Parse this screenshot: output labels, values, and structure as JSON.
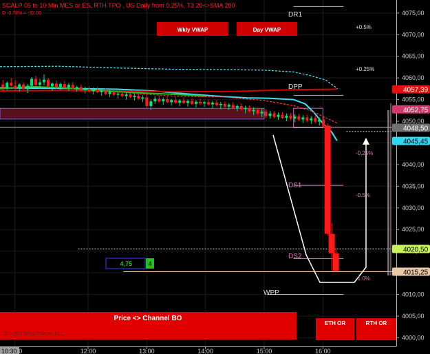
{
  "header": {
    "line1": "SCALP 05 to 10 Min MES or ES, RTH TPO , US Daily from 0.25%, T3 20<>SMA 200",
    "line2": "D -0.78% = -32,00"
  },
  "buttons": {
    "wkly_vwap": "Wkly VWAP",
    "day_vwap": "Day VWAP",
    "channel_bo": "Price <> Channel BO",
    "eth_or": "ETH OR",
    "rth_or": "RTH OR"
  },
  "level_labels": {
    "dr1": "DR1",
    "dpp": "DPP",
    "ds1": "DS1",
    "ds2": "DS2",
    "wpp": "WPP"
  },
  "pct_labels": [
    "+0.5%",
    "+0.25%",
    "-0,25%",
    "-0.5%",
    "-1.0%"
  ],
  "order_box": {
    "value": "4,75",
    "qty": "4"
  },
  "time_badge": "10:30",
  "watermark": "© 2023 NinjaTrader, LLC",
  "colors": {
    "bg": "#000000",
    "up": "#00e676",
    "down": "#ff1a1a",
    "red_panel": "#e00000",
    "vwap_band": "#40e0f0",
    "sma": "#d40000",
    "zone": "#5a0f1e",
    "pink": "#e080c0",
    "cream": "#f0e0c0"
  },
  "chart_data": {
    "type": "candlestick",
    "ylim": [
      3998,
      4078
    ],
    "yticks": [
      "4000,00",
      "4005,00",
      "4010,00",
      "4015,00",
      "4020,00",
      "4025,00",
      "4030,00",
      "4035,00",
      "4040,00",
      "4045,00",
      "4050,00",
      "4055,00",
      "4060,00",
      "4065,00",
      "4070,00",
      "4075,00"
    ],
    "xticks": [
      {
        "label": "11:00",
        "x": 0.25
      },
      {
        "label": "12:00",
        "x": 1.5
      },
      {
        "label": "13:00",
        "x": 2.5
      },
      {
        "label": "14:00",
        "x": 3.5
      },
      {
        "label": "15:00",
        "x": 4.5
      },
      {
        "label": "16:00",
        "x": 5.5
      }
    ],
    "xlim": [
      0,
      6.75
    ],
    "price_tags": [
      {
        "label": "4057,39",
        "value": 4057.39,
        "bg": "#e01010",
        "fg": "#ffffff"
      },
      {
        "label": "4052,75",
        "value": 4052.75,
        "bg": "#d03a6a",
        "fg": "#ffffff"
      },
      {
        "label": "4048,50",
        "value": 4048.5,
        "bg": "#707070",
        "fg": "#ffffff"
      },
      {
        "label": "4045,45",
        "value": 4045.45,
        "bg": "#30d8f0",
        "fg": "#000000"
      },
      {
        "label": "4020,50",
        "value": 4020.5,
        "bg": "#c8f060",
        "fg": "#000000"
      },
      {
        "label": "4015,25",
        "value": 4015.25,
        "bg": "#e8c8a8",
        "fg": "#000000"
      }
    ],
    "levels": [
      {
        "name": "DR1",
        "value": 4076.5
      },
      {
        "name": "DPP",
        "value": 4056.0
      },
      {
        "name": "DS1",
        "value": 4035.2
      },
      {
        "name": "DS2",
        "value": 4018.3
      },
      {
        "name": "WPP",
        "value": 4010.0
      }
    ],
    "zone": {
      "from": 4050.5,
      "to": 4053.0,
      "x0": 0,
      "x1": 4.5
    },
    "box": {
      "from": 4048.5,
      "to": 4053.0,
      "x0": 5.0,
      "x1": 5.5
    },
    "hlines": [
      {
        "value": 4048.6,
        "x0": 0,
        "x1": 6.72,
        "color": "#c8c8c8",
        "dash": false
      },
      {
        "value": 4020.5,
        "x0": 1.33,
        "x1": 6.72,
        "color": "#ffffff",
        "dash": true
      },
      {
        "value": 4015.25,
        "x0": 2.1,
        "x1": 6.72,
        "color": "#e8c8a8",
        "dash": false
      },
      {
        "value": 4047.6,
        "x0": 5.9,
        "x1": 6.72,
        "color": "#ffffff",
        "dash": true
      }
    ],
    "series": [
      {
        "name": "VWAP upper",
        "kind": "dashed",
        "color": "#40e0f0",
        "points": [
          [
            0,
            4062.6
          ],
          [
            1,
            4062.7
          ],
          [
            2,
            4062.3
          ],
          [
            3,
            4062.0
          ],
          [
            4,
            4061.9
          ],
          [
            4.5,
            4061.8
          ],
          [
            5,
            4061.4
          ],
          [
            5.3,
            4060.5
          ],
          [
            5.55,
            4059.5
          ],
          [
            5.75,
            4057.5
          ]
        ]
      },
      {
        "name": "VWAP",
        "kind": "solid",
        "color": "#40e0f0",
        "points": [
          [
            0,
            4057.7
          ],
          [
            1,
            4057.6
          ],
          [
            2,
            4057.4
          ],
          [
            2.6,
            4057.0
          ],
          [
            3.2,
            4056.3
          ],
          [
            3.7,
            4055.8
          ],
          [
            4.2,
            4055.4
          ],
          [
            4.6,
            4055.3
          ],
          [
            5.0,
            4055.0
          ],
          [
            5.2,
            4054.0
          ],
          [
            5.35,
            4052.0
          ],
          [
            5.5,
            4049.5
          ],
          [
            5.65,
            4047.5
          ],
          [
            5.74,
            4045.5
          ]
        ]
      },
      {
        "name": "SMA",
        "kind": "solid",
        "color": "#d40000",
        "points": [
          [
            0,
            4057.0
          ],
          [
            1,
            4057.1
          ],
          [
            2,
            4057.0
          ],
          [
            3,
            4056.8
          ],
          [
            4,
            4056.9
          ],
          [
            5,
            4057.3
          ],
          [
            5.74,
            4057.4
          ]
        ]
      },
      {
        "name": "Green MA",
        "kind": "solid",
        "color": "#20c020",
        "points": [
          [
            0,
            4057.5
          ],
          [
            0.5,
            4058.0
          ],
          [
            1,
            4057.8
          ],
          [
            1.5,
            4057.3
          ],
          [
            2,
            4056.8
          ],
          [
            2.5,
            4056.5
          ],
          [
            3.0,
            4056.2
          ],
          [
            3.5,
            4055.8
          ]
        ]
      },
      {
        "name": "Dashed mid",
        "kind": "dashed",
        "color": "#ff3030",
        "points": [
          [
            2.2,
            4056.5
          ],
          [
            3,
            4055.8
          ],
          [
            3.8,
            4055.6
          ],
          [
            4.5,
            4054.8
          ],
          [
            5.0,
            4053.6
          ],
          [
            5.3,
            4052.4
          ],
          [
            5.6,
            4050.5
          ],
          [
            5.75,
            4049.5
          ]
        ]
      }
    ],
    "candles": [
      [
        0.05,
        4058.5,
        4059.5,
        4057.0,
        4057.8
      ],
      [
        0.12,
        4057.8,
        4059.2,
        4057.2,
        4058.9
      ],
      [
        0.19,
        4058.9,
        4060.0,
        4058.0,
        4058.2
      ],
      [
        0.26,
        4058.2,
        4059.5,
        4057.0,
        4057.6
      ],
      [
        0.33,
        4057.6,
        4058.8,
        4056.8,
        4058.5
      ],
      [
        0.4,
        4058.5,
        4059.0,
        4057.3,
        4057.4
      ],
      [
        0.47,
        4057.4,
        4058.6,
        4056.5,
        4058.2
      ],
      [
        0.54,
        4058.2,
        4060.2,
        4057.8,
        4059.8
      ],
      [
        0.61,
        4059.8,
        4060.5,
        4058.0,
        4058.4
      ],
      [
        0.68,
        4058.4,
        4059.8,
        4057.5,
        4059.0
      ],
      [
        0.75,
        4059.0,
        4060.8,
        4058.3,
        4059.6
      ],
      [
        0.82,
        4059.6,
        4060.0,
        4057.8,
        4058.1
      ],
      [
        0.89,
        4058.1,
        4059.0,
        4057.0,
        4058.7
      ],
      [
        0.96,
        4058.7,
        4059.4,
        4057.5,
        4057.9
      ],
      [
        1.03,
        4057.9,
        4059.0,
        4057.2,
        4058.6
      ],
      [
        1.1,
        4058.6,
        4059.3,
        4057.6,
        4057.8
      ],
      [
        1.17,
        4057.8,
        4058.9,
        4057.0,
        4058.4
      ],
      [
        1.24,
        4058.4,
        4059.1,
        4057.4,
        4057.6
      ],
      [
        1.31,
        4057.6,
        4058.2,
        4056.8,
        4057.9
      ],
      [
        1.38,
        4057.9,
        4058.5,
        4057.0,
        4057.2
      ],
      [
        1.45,
        4057.2,
        4058.0,
        4056.4,
        4057.5
      ],
      [
        1.52,
        4057.5,
        4058.1,
        4056.6,
        4056.9
      ],
      [
        1.59,
        4056.9,
        4057.8,
        4056.2,
        4057.3
      ],
      [
        1.66,
        4057.3,
        4058.0,
        4056.5,
        4056.7
      ],
      [
        1.73,
        4056.7,
        4057.5,
        4055.9,
        4057.0
      ],
      [
        1.8,
        4057.0,
        4057.6,
        4056.0,
        4056.3
      ],
      [
        1.87,
        4056.3,
        4057.2,
        4055.6,
        4056.8
      ],
      [
        1.94,
        4056.8,
        4057.4,
        4055.8,
        4056.1
      ],
      [
        2.01,
        4056.1,
        4056.9,
        4055.2,
        4056.4
      ],
      [
        2.08,
        4056.4,
        4057.0,
        4055.5,
        4055.8
      ],
      [
        2.15,
        4055.8,
        4056.6,
        4055.0,
        4056.2
      ],
      [
        2.22,
        4056.2,
        4056.8,
        4055.3,
        4055.6
      ],
      [
        2.29,
        4055.6,
        4056.4,
        4054.8,
        4055.9
      ],
      [
        2.36,
        4055.9,
        4056.5,
        4055.0,
        4055.2
      ],
      [
        2.43,
        4055.2,
        4056.0,
        4054.4,
        4055.5
      ],
      [
        2.5,
        4055.5,
        4056.3,
        4053.0,
        4053.5
      ],
      [
        2.57,
        4053.5,
        4055.0,
        4052.5,
        4054.6
      ],
      [
        2.64,
        4054.6,
        4055.8,
        4054.0,
        4055.2
      ],
      [
        2.71,
        4055.2,
        4056.0,
        4054.3,
        4054.6
      ],
      [
        2.78,
        4054.6,
        4055.5,
        4053.8,
        4055.1
      ],
      [
        2.85,
        4055.1,
        4055.8,
        4054.2,
        4054.4
      ],
      [
        2.92,
        4054.4,
        4055.2,
        4053.6,
        4054.9
      ],
      [
        2.99,
        4054.9,
        4055.6,
        4054.0,
        4054.3
      ],
      [
        3.06,
        4054.3,
        4055.1,
        4053.5,
        4054.8
      ],
      [
        3.13,
        4054.8,
        4055.5,
        4054.0,
        4054.2
      ],
      [
        3.2,
        4054.2,
        4055.0,
        4053.4,
        4054.7
      ],
      [
        3.27,
        4054.7,
        4055.3,
        4053.8,
        4054.0
      ],
      [
        3.34,
        4054.0,
        4054.9,
        4053.2,
        4054.5
      ],
      [
        3.41,
        4054.5,
        4055.2,
        4053.7,
        4054.1
      ],
      [
        3.48,
        4054.1,
        4054.8,
        4053.3,
        4054.4
      ],
      [
        3.55,
        4054.4,
        4055.0,
        4053.6,
        4053.9
      ],
      [
        3.62,
        4053.9,
        4054.7,
        4053.0,
        4054.3
      ],
      [
        3.69,
        4054.3,
        4054.9,
        4053.4,
        4053.7
      ],
      [
        3.76,
        4053.7,
        4054.5,
        4052.8,
        4054.0
      ],
      [
        3.83,
        4054.0,
        4054.6,
        4053.1,
        4053.4
      ],
      [
        3.9,
        4053.4,
        4054.2,
        4052.6,
        4053.8
      ],
      [
        3.97,
        4053.8,
        4054.4,
        4052.9,
        4053.1
      ],
      [
        4.04,
        4053.1,
        4053.9,
        4052.3,
        4053.5
      ],
      [
        4.11,
        4053.5,
        4054.1,
        4052.5,
        4052.8
      ],
      [
        4.18,
        4052.8,
        4053.6,
        4051.8,
        4053.1
      ],
      [
        4.25,
        4053.1,
        4053.7,
        4052.0,
        4052.3
      ],
      [
        4.32,
        4052.3,
        4053.2,
        4051.4,
        4052.6
      ],
      [
        4.39,
        4052.6,
        4053.1,
        4051.5,
        4051.8
      ],
      [
        4.46,
        4051.8,
        4052.8,
        4051.0,
        4052.2
      ],
      [
        4.53,
        4052.2,
        4052.7,
        4050.8,
        4051.2
      ],
      [
        4.6,
        4051.2,
        4052.4,
        4050.6,
        4051.8
      ],
      [
        4.67,
        4051.8,
        4052.3,
        4050.7,
        4051.0
      ],
      [
        4.74,
        4051.0,
        4052.0,
        4050.3,
        4051.5
      ],
      [
        4.81,
        4051.5,
        4052.1,
        4050.5,
        4050.8
      ],
      [
        4.88,
        4050.8,
        4051.8,
        4050.0,
        4051.3
      ],
      [
        4.95,
        4051.3,
        4051.9,
        4050.2,
        4050.6
      ],
      [
        5.02,
        4050.6,
        4051.6,
        4049.8,
        4051.1
      ],
      [
        5.09,
        4051.1,
        4051.7,
        4050.0,
        4050.4
      ],
      [
        5.16,
        4050.4,
        4051.4,
        4049.6,
        4050.9
      ],
      [
        5.23,
        4050.9,
        4051.5,
        4049.8,
        4050.2
      ],
      [
        5.3,
        4050.2,
        4051.2,
        4049.4,
        4050.7
      ],
      [
        5.37,
        4050.7,
        4051.3,
        4049.5,
        4049.9
      ],
      [
        5.44,
        4049.9,
        4050.9,
        4049.0,
        4050.4
      ],
      [
        5.51,
        4050.4,
        4051.0,
        4048.5,
        4049.0
      ],
      [
        5.58,
        4049.0,
        4049.5,
        4023.5,
        4024.0
      ],
      [
        5.65,
        4024.0,
        4026.5,
        4015.5,
        4019.5
      ],
      [
        5.72,
        4019.5,
        4020.5,
        4015.0,
        4015.5
      ]
    ]
  }
}
